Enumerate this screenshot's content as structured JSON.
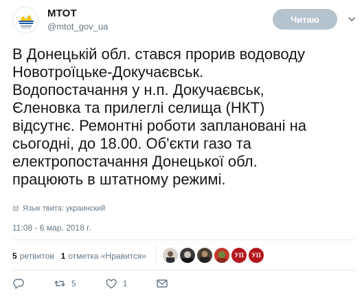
{
  "account": {
    "name": "МТОТ",
    "handle": "@mtot_gov_ua",
    "avatar_icon": "mtot-logo-icon"
  },
  "follow_button": {
    "label": "Читаю"
  },
  "tweet": {
    "lines": [
      "В Донецькій обл. стався прорив водоводу",
      "Новотроїцьке-Докучаєвськ.",
      "Водопостачання у н.п. Докучаєвськ,",
      "Єленовка та прилеглі селища (НКТ)",
      "відсутнє. Ремонтні роботи заплановані на",
      "сьогодні, до 18.00. Об'єкти газо та",
      "електропостачання Донецької обл.",
      "працюють в штатному режимі."
    ],
    "language": "Язык твита: украинский",
    "timestamp": "11:08 - 6 мар. 2018 г."
  },
  "stats": {
    "retweets_count": "5",
    "retweets_label": "ретвитов",
    "likes_count": "1",
    "likes_label": "отметка «Нравится»",
    "badge_text": "УП"
  },
  "actions": {
    "reply_icon": "reply-icon",
    "retweet_icon": "retweet-icon",
    "retweet_count": "5",
    "like_icon": "heart-icon",
    "like_count": "1",
    "dm_icon": "envelope-icon"
  },
  "colors": {
    "text": "#14171a",
    "muted": "#657786",
    "follow_button_bg": "#b5c3ce",
    "divider": "#e6ecf0",
    "badge": "#b3161b"
  }
}
